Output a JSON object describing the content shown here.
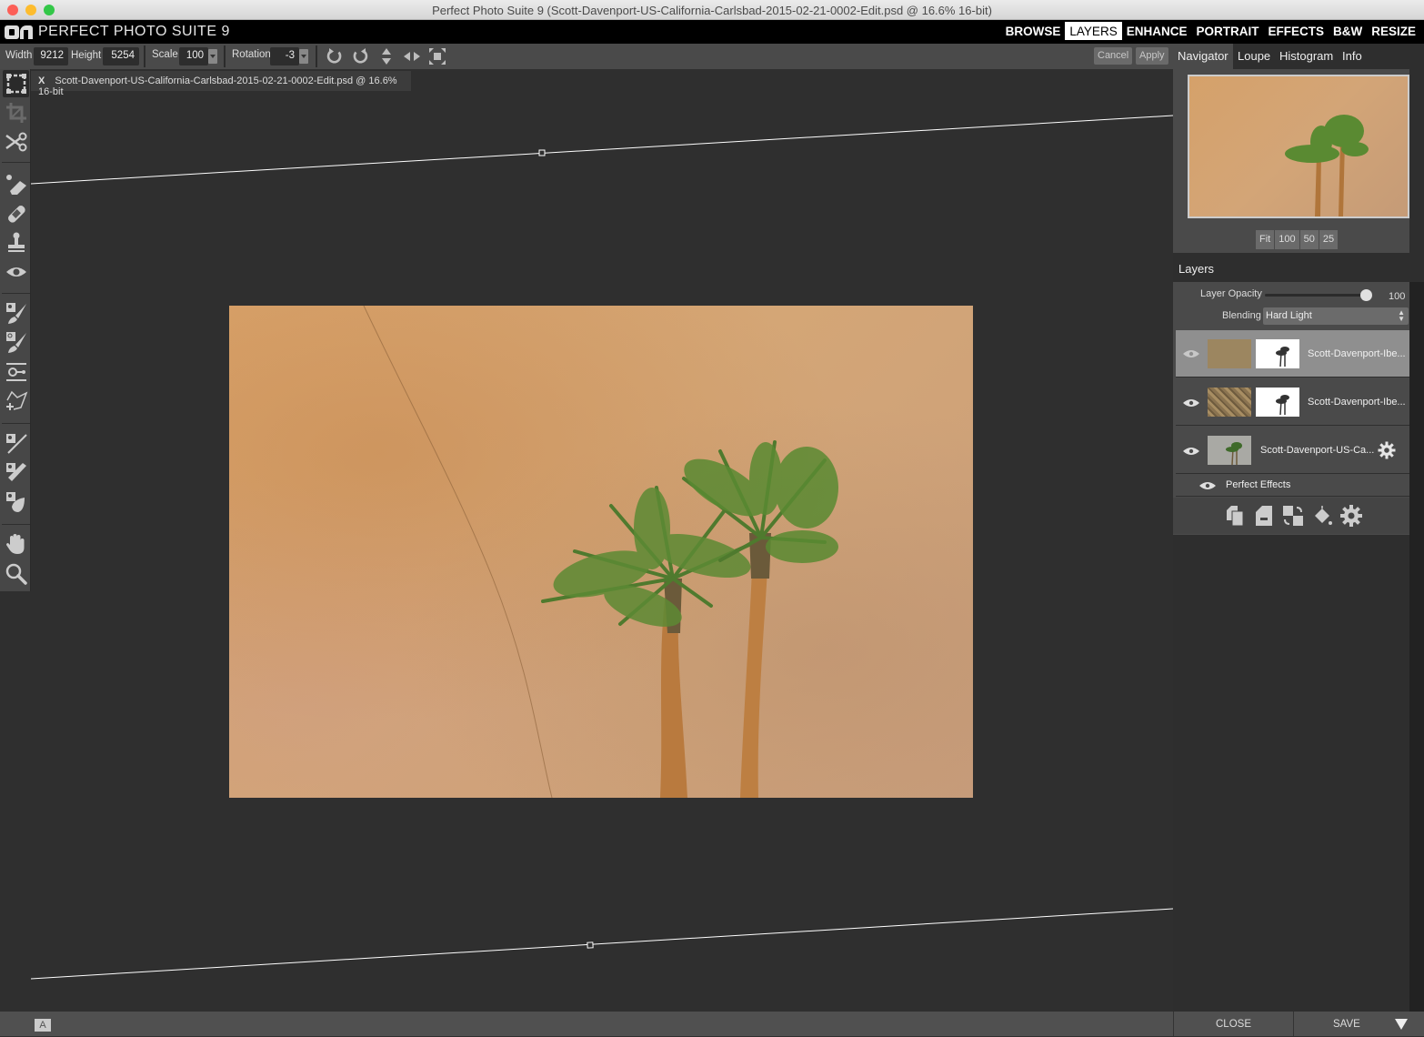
{
  "window": {
    "title": "Perfect Photo Suite 9 (Scott-Davenport-US-California-Carlsbad-2015-02-21-0002-Edit.psd @ 16.6% 16-bit)",
    "traffic_lights": {
      "close": "#fc5f57",
      "minimize": "#fdbc2e",
      "zoom": "#33c748"
    }
  },
  "app": {
    "logo": "on1-logo",
    "name": "PERFECT PHOTO SUITE 9",
    "modules": [
      {
        "label": "BROWSE",
        "active": false
      },
      {
        "label": "LAYERS",
        "active": true
      },
      {
        "label": "ENHANCE",
        "active": false
      },
      {
        "label": "PORTRAIT",
        "active": false
      },
      {
        "label": "EFFECTS",
        "active": false
      },
      {
        "label": "B&W",
        "active": false
      },
      {
        "label": "RESIZE",
        "active": false
      }
    ]
  },
  "toolbar": {
    "width_label": "Width",
    "width_value": "9212",
    "height_label": "Height",
    "height_value": "5254",
    "scale_label": "Scale",
    "scale_value": "100",
    "rotation_label": "Rotation",
    "rotation_value": "-3",
    "icons": [
      "rotate-clockwise-icon",
      "rotate-counterclockwise-icon",
      "flip-vertical-icon",
      "flip-horizontal-icon",
      "fit-expand-icon"
    ],
    "cancel_label": "Cancel",
    "apply_label": "Apply"
  },
  "tools": [
    {
      "name": "transform-tool",
      "active": true
    },
    {
      "name": "crop-tool",
      "active": false,
      "disabled": true
    },
    {
      "name": "cut-scissors-tool",
      "active": false
    },
    {
      "name": "perfect-eraser-tool",
      "active": false
    },
    {
      "name": "retouch-brush-tool",
      "active": false
    },
    {
      "name": "clone-stamp-tool",
      "active": false
    },
    {
      "name": "red-eye-tool",
      "active": false
    },
    {
      "name": "masking-brush-tool",
      "active": false
    },
    {
      "name": "masking-brush-find-tool",
      "active": false
    },
    {
      "name": "masking-bug-tool",
      "active": false
    },
    {
      "name": "lasso-tool",
      "active": false
    },
    {
      "name": "refine-brush-tool",
      "active": false
    },
    {
      "name": "chisel-tool",
      "active": false
    },
    {
      "name": "blur-tool",
      "active": false
    },
    {
      "name": "hand-tool",
      "active": false
    },
    {
      "name": "zoom-tool",
      "active": false
    }
  ],
  "document": {
    "tab_close": "X",
    "tab_label": "Scott-Davenport-US-California-Carlsbad-2015-02-21-0002-Edit.psd @ 16.6% 16-bit",
    "rotation_degrees": -3
  },
  "panel": {
    "tabs": [
      {
        "label": "Navigator",
        "active": true
      },
      {
        "label": "Loupe",
        "active": false
      },
      {
        "label": "Histogram",
        "active": false
      },
      {
        "label": "Info",
        "active": false
      }
    ],
    "zoom_buttons": [
      "Fit",
      "100",
      "50",
      "25"
    ],
    "layers_title": "Layers",
    "opacity_label": "Layer Opacity",
    "opacity_value": "100",
    "opacity_fraction": 1.0,
    "blending_label": "Blending",
    "blending_value": "Hard Light",
    "layers": [
      {
        "name": "Scott-Davenport-Ibe...",
        "visible": true,
        "selected": true,
        "has_mask": true,
        "has_settings": false,
        "thumb_color": "#9c8660"
      },
      {
        "name": "Scott-Davenport-Ibe...",
        "visible": true,
        "selected": false,
        "has_mask": true,
        "has_settings": false,
        "thumb_color": "#8f7a58"
      },
      {
        "name": "Scott-Davenport-US-Ca...",
        "visible": true,
        "selected": false,
        "has_mask": false,
        "has_settings": true,
        "thumb_color": "#a9a9a4"
      }
    ],
    "effects_row": "Perfect Effects",
    "layer_actions": [
      "duplicate-layer-icon",
      "new-layer-icon",
      "merge-layers-icon",
      "fill-bucket-icon",
      "settings-gear-icon"
    ]
  },
  "footer": {
    "badge": "A",
    "close_label": "CLOSE",
    "save_label": "SAVE"
  }
}
